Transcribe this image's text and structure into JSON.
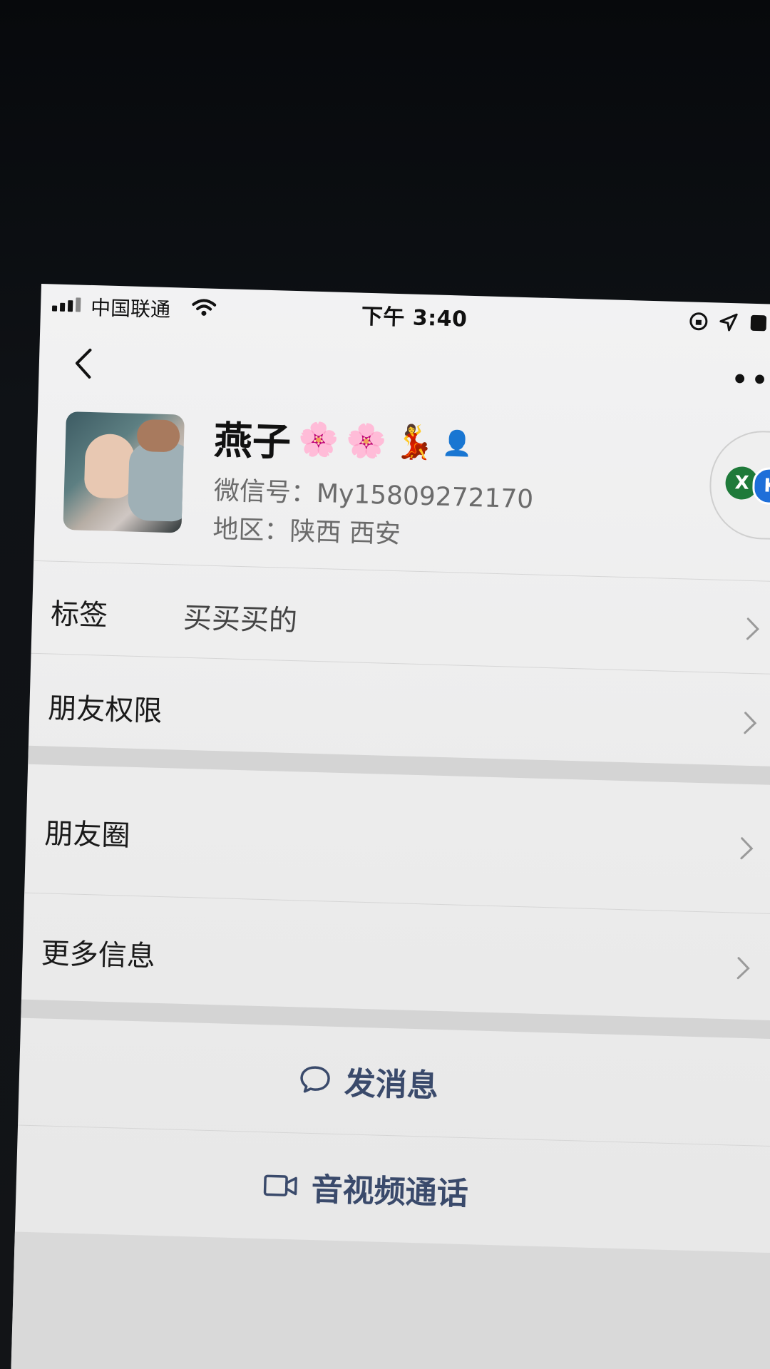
{
  "status_bar": {
    "carrier": "中国联通",
    "time": "下午 3:40"
  },
  "icons": {
    "back": "chevron-left-icon",
    "more": "ellipsis-icon",
    "chat": "chat-bubble-icon",
    "video": "video-camera-icon",
    "row_arrow": "chevron-right-icon"
  },
  "profile": {
    "name": "燕子",
    "badges": [
      "🌸",
      "🌸",
      "💃",
      "👤"
    ],
    "wechat_id": "微信号：My15809272170",
    "region": "地区：陕西 西安"
  },
  "rows": {
    "tags": {
      "label": "标签",
      "value": "买买买的"
    },
    "permissions": {
      "label": "朋友权限"
    },
    "moments": {
      "label": "朋友圈"
    },
    "more_info": {
      "label": "更多信息"
    }
  },
  "actions": {
    "message": "发消息",
    "call": "音视频通话"
  },
  "status_pill": {
    "left_letter": "X",
    "right_letter": "K"
  },
  "colors": {
    "action_text": "#3a4a6b",
    "pill_green": "#1f7a3a",
    "pill_blue": "#1e6fd9"
  }
}
